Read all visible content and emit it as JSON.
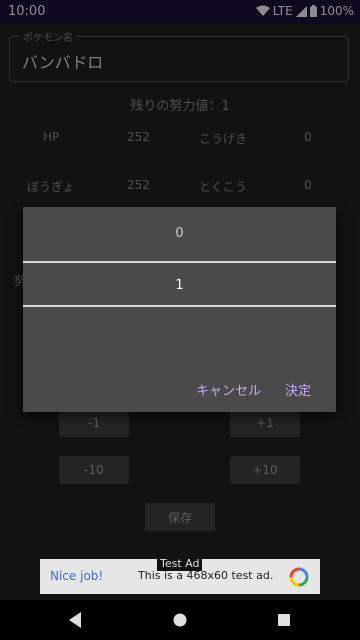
{
  "status_bar": {
    "time": "10:00",
    "network": "LTE",
    "battery": "100%"
  },
  "pokemon_name": {
    "label": "ポケモン名",
    "value": "バンバドロ"
  },
  "remaining_effort": "残りの努力値：1",
  "stats": [
    {
      "name": "HP",
      "value": "252",
      "name2": "こうげき",
      "value2": "0"
    },
    {
      "name": "ぼうぎょ",
      "value": "252",
      "name2": "とくこう",
      "value2": "0"
    }
  ],
  "partial_label": "努",
  "buttons": {
    "minus1": "-1",
    "plus1": "+1",
    "minus10": "-10",
    "plus10": "+10",
    "save": "保存"
  },
  "dialog": {
    "values": [
      "0",
      "1"
    ],
    "cancel": "キャンセル",
    "ok": "決定"
  },
  "ad": {
    "caption": "Test Ad",
    "nice": "Nice job!",
    "text": "This is a 468x60 test ad."
  }
}
